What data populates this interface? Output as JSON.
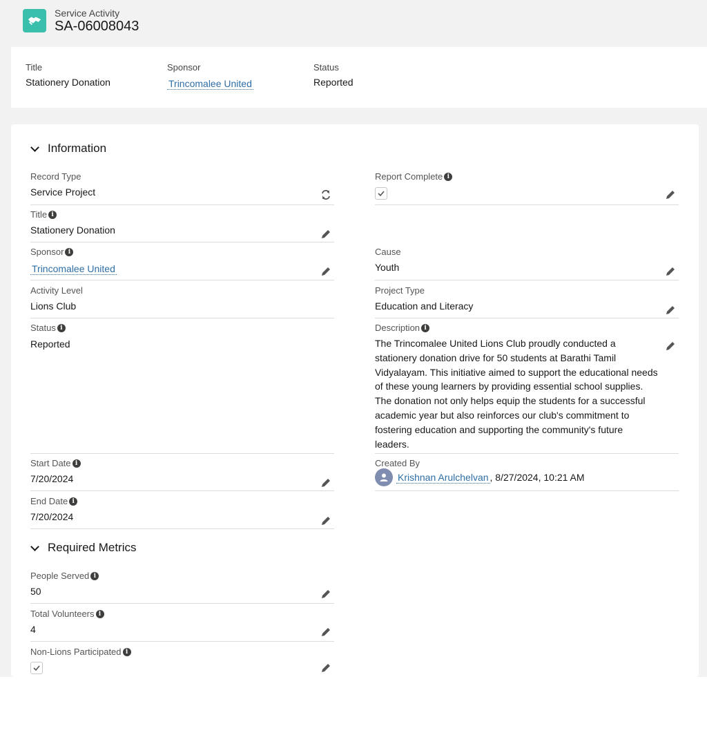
{
  "header": {
    "object_type": "Service Activity",
    "record_name": "SA-06008043",
    "icon": "handshake-icon",
    "icon_color": "#3bbfad"
  },
  "highlights": [
    {
      "label": "Title",
      "value": "Stationery Donation"
    },
    {
      "label": "Sponsor",
      "value": "Trincomalee United"
    },
    {
      "label": "Status",
      "value": "Reported"
    }
  ],
  "sections": {
    "information": "Information",
    "required_metrics": "Required Metrics"
  },
  "fields": {
    "record_type": {
      "label": "Record Type",
      "value": "Service Project"
    },
    "title": {
      "label": "Title",
      "value": "Stationery Donation"
    },
    "sponsor": {
      "label": "Sponsor",
      "value": "Trincomalee United"
    },
    "activity_level": {
      "label": "Activity Level",
      "value": "Lions Club"
    },
    "status": {
      "label": "Status",
      "value": "Reported"
    },
    "start_date": {
      "label": "Start Date",
      "value": "7/20/2024"
    },
    "end_date": {
      "label": "End Date",
      "value": "7/20/2024"
    },
    "report_complete": {
      "label": "Report Complete",
      "checked": true
    },
    "cause": {
      "label": "Cause",
      "value": "Youth"
    },
    "project_type": {
      "label": "Project Type",
      "value": "Education and Literacy"
    },
    "description": {
      "label": "Description",
      "value": "The Trincomalee United Lions Club proudly conducted a stationery donation drive for 50 students at Barathi Tamil Vidyalayam. This initiative aimed to support the educational needs of these young learners by providing essential school supplies. The donation not only helps equip the students for a successful academic year but also reinforces our club's commitment to fostering education and supporting the community's future leaders."
    },
    "created_by": {
      "label": "Created By",
      "user": "Krishnan Arulchelvan",
      "timestamp": ", 8/27/2024, 10:21 AM"
    },
    "people_served": {
      "label": "People Served",
      "value": "50"
    },
    "total_volunteers": {
      "label": "Total Volunteers",
      "value": "4"
    },
    "non_lions": {
      "label": "Non-Lions Participated",
      "checked": true
    }
  },
  "colors": {
    "link": "#2e6ea6",
    "background": "#f3f2f2",
    "border": "#dddbda"
  }
}
